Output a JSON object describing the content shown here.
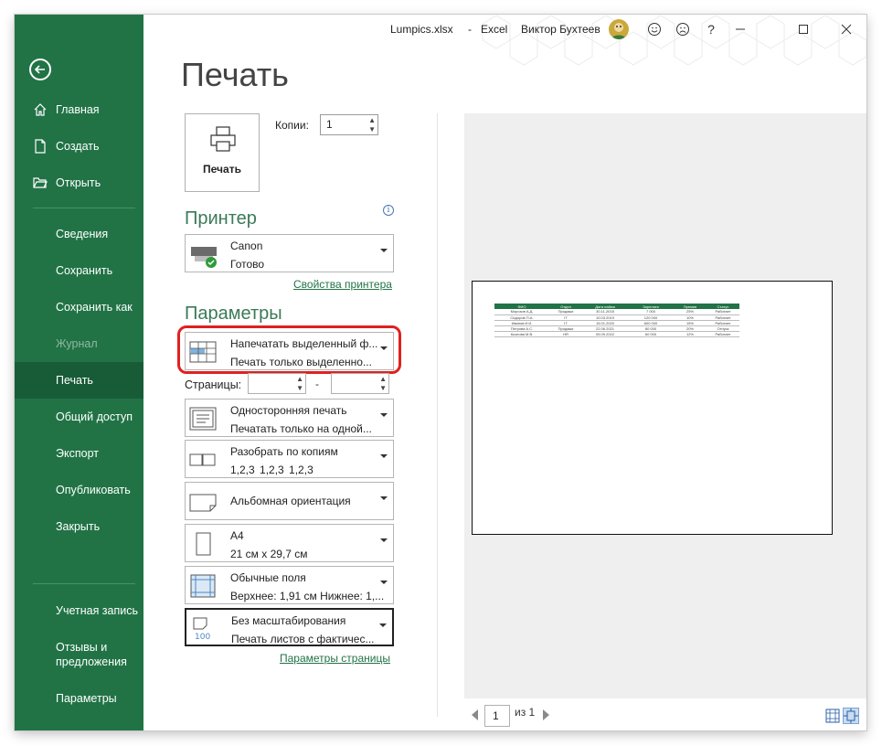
{
  "window": {
    "file": "Lumpics.xlsx",
    "sep": "-",
    "app": "Excel",
    "user": "Виктор Бухтеев",
    "help": "?"
  },
  "sidebar": {
    "top_items": [
      {
        "label": "Главная",
        "icon": "home-icon"
      },
      {
        "label": "Создать",
        "icon": "new-document-icon"
      },
      {
        "label": "Открыть",
        "icon": "open-folder-icon"
      }
    ],
    "middle_items": [
      {
        "label": "Сведения"
      },
      {
        "label": "Сохранить"
      },
      {
        "label": "Сохранить как"
      },
      {
        "label": "Журнал",
        "disabled": true
      },
      {
        "label": "Печать",
        "active": true
      },
      {
        "label": "Общий доступ"
      },
      {
        "label": "Экспорт"
      },
      {
        "label": "Опубликовать"
      },
      {
        "label": "Закрыть"
      }
    ],
    "bottom_items": [
      {
        "label": "Учетная запись"
      },
      {
        "label": "Отзывы и предложения"
      },
      {
        "label": "Параметры"
      }
    ]
  },
  "print": {
    "title": "Печать",
    "button_label": "Печать",
    "copies_label": "Копии:",
    "copies_value": "1",
    "printer_heading": "Принтер",
    "printer_name": "Canon",
    "printer_status": "Готово",
    "printer_properties_link": "Свойства принтера",
    "settings_heading": "Параметры",
    "settings": [
      {
        "line1": "Напечатать выделенный ф...",
        "line2": "Печать только выделенно...",
        "icon": "selection-icon"
      },
      {
        "line1": "Односторонняя печать",
        "line2": "Печатать только на одной...",
        "icon": "one-sided-icon"
      },
      {
        "line1": "Разобрать по копиям",
        "line2": "1,2,3    1,2,3    1,2,3",
        "icon": "collated-icon"
      },
      {
        "line1": "Альбомная ориентация",
        "line2": "",
        "icon": "landscape-icon"
      },
      {
        "line1": "A4",
        "line2": "21 см x 29,7 см",
        "icon": "paper-size-icon"
      },
      {
        "line1": "Обычные поля",
        "line2": "Верхнее: 1,91 см Нижнее: 1,...",
        "icon": "margins-icon"
      },
      {
        "line1": "Без масштабирования",
        "line2": "Печать листов с фактичес...",
        "icon": "scaling-icon"
      }
    ],
    "pages_label": "Страницы:",
    "pages_dash": "-",
    "page_setup_link": "Параметры страницы"
  },
  "preview": {
    "table_headers": [
      "ФИО",
      "Отдел",
      "Дата найма",
      "Зарплата",
      "Премия",
      "Статус"
    ],
    "table_rows": [
      [
        "Морозов А.Д.",
        "Продажи",
        "30.11.2018",
        "7 000",
        "25%",
        "Работает"
      ],
      [
        "Сидоров П.А.",
        "IT",
        "10.03.2019",
        "120 000",
        "10%",
        "Работает"
      ],
      [
        "Иванов И.И.",
        "IT",
        "15.01.2020",
        "600 000",
        "15%",
        "Работает"
      ],
      [
        "Петрова А.С.",
        "Продажи",
        "22.06.2021",
        "80 000",
        "20%",
        "Отпуск"
      ],
      [
        "Козлова М.В.",
        "HR",
        "05.09.2022",
        "60 000",
        "12%",
        "Работает"
      ]
    ],
    "page_current": "1",
    "page_of": "из 1"
  },
  "colors": {
    "accent": "#217346",
    "active_nav": "#185c37",
    "highlight": "#e02020"
  }
}
